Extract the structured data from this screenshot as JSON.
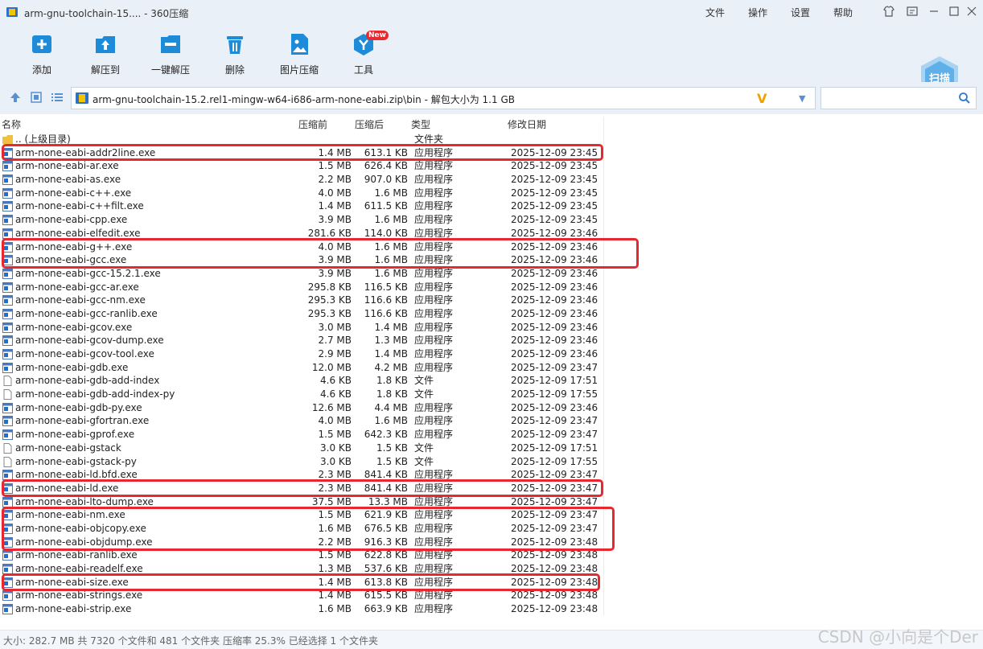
{
  "window": {
    "title": "arm-gnu-toolchain-15.... - 360压缩",
    "menu": [
      "文件",
      "操作",
      "设置",
      "帮助"
    ]
  },
  "toolbar": {
    "buttons": [
      {
        "label": "添加",
        "icon": "add-file-icon"
      },
      {
        "label": "解压到",
        "icon": "extract-folder-icon"
      },
      {
        "label": "一键解压",
        "icon": "one-click-extract-icon"
      },
      {
        "label": "删除",
        "icon": "trash-icon"
      },
      {
        "label": "图片压缩",
        "icon": "image-compress-icon"
      },
      {
        "label": "工具",
        "icon": "tools-icon",
        "badge": "New"
      }
    ],
    "scan_label": "扫描"
  },
  "address": {
    "path": "arm-gnu-toolchain-15.2.rel1-mingw-w64-i686-arm-none-eabi.zip\\bin - 解包大小为 1.1 GB",
    "search_placeholder": ""
  },
  "columns": {
    "name": "名称",
    "packed": "压缩前",
    "orig": "压缩后",
    "type": "类型",
    "date": "修改日期"
  },
  "files": [
    {
      "name": ".. (上级目录)",
      "packed": "",
      "orig": "",
      "type": "文件夹",
      "date": "",
      "kind": "folder"
    },
    {
      "name": "arm-none-eabi-addr2line.exe",
      "packed": "1.4 MB",
      "orig": "613.1 KB",
      "type": "应用程序",
      "date": "2025-12-09 23:45",
      "kind": "exe"
    },
    {
      "name": "arm-none-eabi-ar.exe",
      "packed": "1.5 MB",
      "orig": "626.4 KB",
      "type": "应用程序",
      "date": "2025-12-09 23:45",
      "kind": "exe"
    },
    {
      "name": "arm-none-eabi-as.exe",
      "packed": "2.2 MB",
      "orig": "907.0 KB",
      "type": "应用程序",
      "date": "2025-12-09 23:45",
      "kind": "exe"
    },
    {
      "name": "arm-none-eabi-c++.exe",
      "packed": "4.0 MB",
      "orig": "1.6 MB",
      "type": "应用程序",
      "date": "2025-12-09 23:45",
      "kind": "exe"
    },
    {
      "name": "arm-none-eabi-c++filt.exe",
      "packed": "1.4 MB",
      "orig": "611.5 KB",
      "type": "应用程序",
      "date": "2025-12-09 23:45",
      "kind": "exe"
    },
    {
      "name": "arm-none-eabi-cpp.exe",
      "packed": "3.9 MB",
      "orig": "1.6 MB",
      "type": "应用程序",
      "date": "2025-12-09 23:45",
      "kind": "exe"
    },
    {
      "name": "arm-none-eabi-elfedit.exe",
      "packed": "281.6 KB",
      "orig": "114.0 KB",
      "type": "应用程序",
      "date": "2025-12-09 23:46",
      "kind": "exe"
    },
    {
      "name": "arm-none-eabi-g++.exe",
      "packed": "4.0 MB",
      "orig": "1.6 MB",
      "type": "应用程序",
      "date": "2025-12-09 23:46",
      "kind": "exe"
    },
    {
      "name": "arm-none-eabi-gcc.exe",
      "packed": "3.9 MB",
      "orig": "1.6 MB",
      "type": "应用程序",
      "date": "2025-12-09 23:46",
      "kind": "exe"
    },
    {
      "name": "arm-none-eabi-gcc-15.2.1.exe",
      "packed": "3.9 MB",
      "orig": "1.6 MB",
      "type": "应用程序",
      "date": "2025-12-09 23:46",
      "kind": "exe"
    },
    {
      "name": "arm-none-eabi-gcc-ar.exe",
      "packed": "295.8 KB",
      "orig": "116.5 KB",
      "type": "应用程序",
      "date": "2025-12-09 23:46",
      "kind": "exe"
    },
    {
      "name": "arm-none-eabi-gcc-nm.exe",
      "packed": "295.3 KB",
      "orig": "116.6 KB",
      "type": "应用程序",
      "date": "2025-12-09 23:46",
      "kind": "exe"
    },
    {
      "name": "arm-none-eabi-gcc-ranlib.exe",
      "packed": "295.3 KB",
      "orig": "116.6 KB",
      "type": "应用程序",
      "date": "2025-12-09 23:46",
      "kind": "exe"
    },
    {
      "name": "arm-none-eabi-gcov.exe",
      "packed": "3.0 MB",
      "orig": "1.4 MB",
      "type": "应用程序",
      "date": "2025-12-09 23:46",
      "kind": "exe"
    },
    {
      "name": "arm-none-eabi-gcov-dump.exe",
      "packed": "2.7 MB",
      "orig": "1.3 MB",
      "type": "应用程序",
      "date": "2025-12-09 23:46",
      "kind": "exe"
    },
    {
      "name": "arm-none-eabi-gcov-tool.exe",
      "packed": "2.9 MB",
      "orig": "1.4 MB",
      "type": "应用程序",
      "date": "2025-12-09 23:46",
      "kind": "exe"
    },
    {
      "name": "arm-none-eabi-gdb.exe",
      "packed": "12.0 MB",
      "orig": "4.2 MB",
      "type": "应用程序",
      "date": "2025-12-09 23:47",
      "kind": "exe"
    },
    {
      "name": "arm-none-eabi-gdb-add-index",
      "packed": "4.6 KB",
      "orig": "1.8 KB",
      "type": "文件",
      "date": "2025-12-09 17:51",
      "kind": "file"
    },
    {
      "name": "arm-none-eabi-gdb-add-index-py",
      "packed": "4.6 KB",
      "orig": "1.8 KB",
      "type": "文件",
      "date": "2025-12-09 17:55",
      "kind": "file"
    },
    {
      "name": "arm-none-eabi-gdb-py.exe",
      "packed": "12.6 MB",
      "orig": "4.4 MB",
      "type": "应用程序",
      "date": "2025-12-09 23:46",
      "kind": "exe"
    },
    {
      "name": "arm-none-eabi-gfortran.exe",
      "packed": "4.0 MB",
      "orig": "1.6 MB",
      "type": "应用程序",
      "date": "2025-12-09 23:47",
      "kind": "exe"
    },
    {
      "name": "arm-none-eabi-gprof.exe",
      "packed": "1.5 MB",
      "orig": "642.3 KB",
      "type": "应用程序",
      "date": "2025-12-09 23:47",
      "kind": "exe"
    },
    {
      "name": "arm-none-eabi-gstack",
      "packed": "3.0 KB",
      "orig": "1.5 KB",
      "type": "文件",
      "date": "2025-12-09 17:51",
      "kind": "file"
    },
    {
      "name": "arm-none-eabi-gstack-py",
      "packed": "3.0 KB",
      "orig": "1.5 KB",
      "type": "文件",
      "date": "2025-12-09 17:55",
      "kind": "file"
    },
    {
      "name": "arm-none-eabi-ld.bfd.exe",
      "packed": "2.3 MB",
      "orig": "841.4 KB",
      "type": "应用程序",
      "date": "2025-12-09 23:47",
      "kind": "exe"
    },
    {
      "name": "arm-none-eabi-ld.exe",
      "packed": "2.3 MB",
      "orig": "841.4 KB",
      "type": "应用程序",
      "date": "2025-12-09 23:47",
      "kind": "exe"
    },
    {
      "name": "arm-none-eabi-lto-dump.exe",
      "packed": "37.5 MB",
      "orig": "13.3 MB",
      "type": "应用程序",
      "date": "2025-12-09 23:47",
      "kind": "exe"
    },
    {
      "name": "arm-none-eabi-nm.exe",
      "packed": "1.5 MB",
      "orig": "621.9 KB",
      "type": "应用程序",
      "date": "2025-12-09 23:47",
      "kind": "exe"
    },
    {
      "name": "arm-none-eabi-objcopy.exe",
      "packed": "1.6 MB",
      "orig": "676.5 KB",
      "type": "应用程序",
      "date": "2025-12-09 23:47",
      "kind": "exe"
    },
    {
      "name": "arm-none-eabi-objdump.exe",
      "packed": "2.2 MB",
      "orig": "916.3 KB",
      "type": "应用程序",
      "date": "2025-12-09 23:48",
      "kind": "exe"
    },
    {
      "name": "arm-none-eabi-ranlib.exe",
      "packed": "1.5 MB",
      "orig": "622.8 KB",
      "type": "应用程序",
      "date": "2025-12-09 23:48",
      "kind": "exe"
    },
    {
      "name": "arm-none-eabi-readelf.exe",
      "packed": "1.3 MB",
      "orig": "537.6 KB",
      "type": "应用程序",
      "date": "2025-12-09 23:48",
      "kind": "exe"
    },
    {
      "name": "arm-none-eabi-size.exe",
      "packed": "1.4 MB",
      "orig": "613.8 KB",
      "type": "应用程序",
      "date": "2025-12-09 23:48",
      "kind": "exe"
    },
    {
      "name": "arm-none-eabi-strings.exe",
      "packed": "1.4 MB",
      "orig": "615.5 KB",
      "type": "应用程序",
      "date": "2025-12-09 23:48",
      "kind": "exe"
    },
    {
      "name": "arm-none-eabi-strip.exe",
      "packed": "1.6 MB",
      "orig": "663.9 KB",
      "type": "应用程序",
      "date": "2025-12-09 23:48",
      "kind": "exe"
    }
  ],
  "status": "大小: 282.7 MB 共 7320 个文件和 481 个文件夹 压缩率 25.3% 已经选择 1 个文件夹",
  "watermark": "CSDN @小向是个Der",
  "colors": {
    "accent": "#1e8bd8",
    "highlight": "#e8282f",
    "chrome": "#eaf0f8"
  }
}
